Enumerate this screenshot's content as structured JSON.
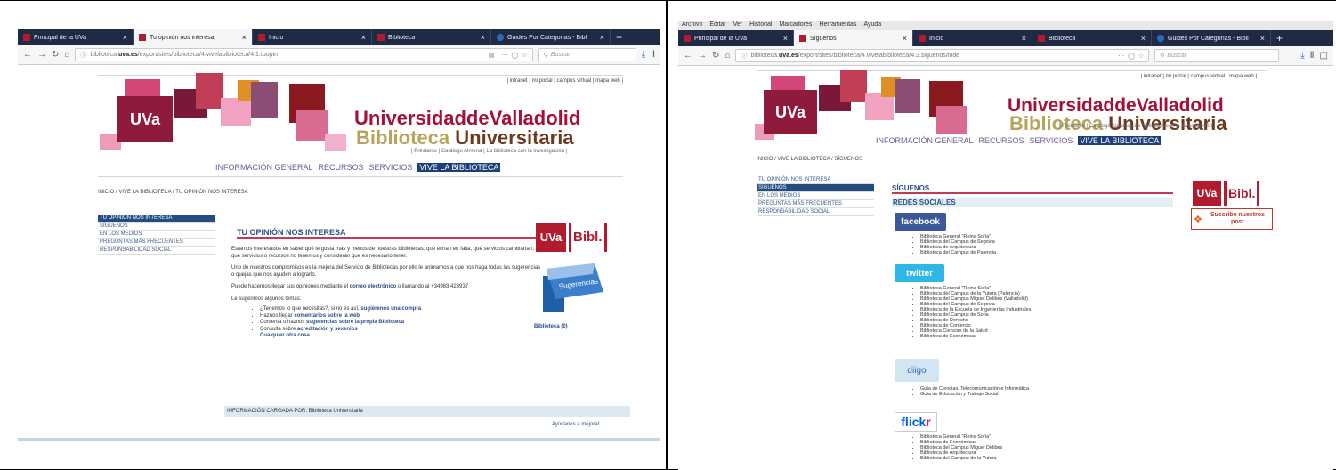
{
  "left": {
    "tabs": [
      {
        "label": "Principal de la UVa",
        "active": false
      },
      {
        "label": "Tu opinión nos interesa",
        "active": true
      },
      {
        "label": "Inicio",
        "active": false
      },
      {
        "label": "Biblioteca",
        "active": false
      },
      {
        "label": "Guides Por Categorías - Bibl",
        "active": false
      }
    ],
    "url_prefix": "biblioteca.",
    "url_domain": "uva.es",
    "url_rest": "/export/sites/biblioteca/4.vivelabiblioteca/4.1.tuopin",
    "search_placeholder": "Buscar",
    "top_links": "| intranet | mi portal | campus virtual | mapa web |",
    "logo_text": "UVa",
    "univ_text": "UniversidaddeValladolid",
    "bib_text_a": "Biblioteca ",
    "bib_text_b": "Universitaria",
    "sub_links": "| Préstamo | Catálogo Almena | La biblioteca con la investigación |",
    "nav": [
      "INFORMACIÓN GENERAL",
      "RECURSOS",
      "SERVICIOS",
      "VIVE LA BIBLIOTECA"
    ],
    "breadcrumb": "INICIO  /  VIVE LA BIBLIOTECA  /  TU OPINIÓN NOS INTERESA",
    "side": [
      "TU OPINIÓN NOS INTERESA",
      "SÍGUENOS",
      "EN LOS MEDIOS",
      "PREGUNTAS MÁS FRECUENTES",
      "RESPONSABILIDAD SOCIAL"
    ],
    "heading": "TU OPINIÓN NOS INTERESA",
    "p1": "Estamos interesados en saber qué le gusta más y menos de nuestras bibliotecas: qué echan en falta, qué servicios cambiarían, qué servicios o recursos no tenemos y consideran que es necesario tener.",
    "p2": "Uno de nuestros compromisos es la mejora del Servicio de Bibliotecas por ello le animamos a que nos haga todas las sugerencias o quejas que nos ayuden a lograrlo.",
    "p3_a": "Puede hacernos llegar sus opiniones mediante el ",
    "p3_link": "correo electrónico",
    "p3_b": " o llamando al +34983 423937",
    "p4": "Le sugerimos algunos temas:",
    "bullets": [
      {
        "pre": "¿Tenemos lo que necesitas?, si no es así, ",
        "link": "sugiérenos una compra"
      },
      {
        "pre": "Haznos llegar ",
        "link": "comentarios sobre la web"
      },
      {
        "pre": "Comenta o haznos ",
        "link": "sugerencias sobre la propia Biblioteca"
      },
      {
        "pre": "Consulta sobre ",
        "link": "acreditación y sexenios"
      },
      {
        "pre": "",
        "link": "Cualquier otra cosa"
      }
    ],
    "badge_uva": "UVa",
    "badge_bibl": "Bibl.",
    "mailbox_text": "Sugerencias y Quejas",
    "mailbox_caption": "Biblioteca (0)",
    "footer": "INFORMACIÓN CARGADA POR: Biblioteca Universitaria",
    "help": "Ayúdanos a mejorar"
  },
  "right": {
    "menubar": [
      "Archivo",
      "Editar",
      "Ver",
      "Historial",
      "Marcadores",
      "Herramientas",
      "Ayuda"
    ],
    "tabs": [
      {
        "label": "Principal de la UVa",
        "active": false
      },
      {
        "label": "Síguenos",
        "active": true
      },
      {
        "label": "Inicio",
        "active": false
      },
      {
        "label": "Biblioteca",
        "active": false
      },
      {
        "label": "Guides Por Categorías - Bibli",
        "active": false
      }
    ],
    "url_prefix": "biblioteca.",
    "url_domain": "uva.es",
    "url_rest": "/export/sites/biblioteca/4.vivelabiblioteca/4.3.siguenos/inde",
    "search_placeholder": "Buscar",
    "top_links": "| intranet | mi portal | campus virtual | mapa web |",
    "logo_text": "UVa",
    "univ_text": "UniversidaddeValladolid",
    "bib_text_a": "Biblioteca ",
    "bib_text_b": "Universitaria",
    "sub_links": "| Préstamo | Catálogo Almena | La biblioteca con la investigación |",
    "nav": [
      "INFORMACIÓN GENERAL",
      "RECURSOS",
      "SERVICIOS",
      "VIVE LA BIBLIOTECA"
    ],
    "breadcrumb": "INICIO  /  VIVE LA BIBLIOTECA  /  SÍGUENOS",
    "side": [
      "TU OPINIÓN NOS INTERESA",
      "SÍGUENOS",
      "EN LOS MEDIOS",
      "PREGUNTAS MÁS FRECUENTES",
      "RESPONSABILIDAD SOCIAL"
    ],
    "heading": "SÍGUENOS",
    "subheading": "REDES SOCIALES",
    "facebook": "facebook",
    "fb_list": [
      "Biblioteca General \"Reina Sofía\"",
      "Biblioteca del Campus de Segovia",
      "Biblioteca de Arquitectura",
      "Biblioteca del Campus de Palencia"
    ],
    "twitter": "twitter",
    "tw_list": [
      "Biblioteca General \"Reina Sofía\"",
      "Biblioteca del Campus de la Yutera (Palencia)",
      "Biblioteca del Campus Miguel Delibes (Valladolid)",
      "Biblioteca del Campus de Segovia",
      "Biblioteca de la Escuela de Ingenierías Industriales",
      "Biblioteca del Campus de Soria",
      "Biblioteca de Derecho",
      "Biblioteca de Comercio",
      "Biblioteca Ciencias de la Salud",
      "Biblioteca de Económicas"
    ],
    "diigo": "diigo",
    "dg_list": [
      "Guía de Ciencias, Telecomunicación e Informática",
      "Guía de Educación y Trabajo Social"
    ],
    "flickr_a": "flick",
    "flickr_b": "r",
    "fl_list": [
      "Biblioteca General \"Reina Sofía\"",
      "Biblioteca de Económicas",
      "Biblioteca del Campus Miguel Delibes",
      "Biblioteca de Arquitectura",
      "Biblioteca del Campus de la Yutera"
    ],
    "badge_uva": "UVa",
    "badge_bibl": "Bibl.",
    "subscribe": "Suscribe nuestros post"
  }
}
